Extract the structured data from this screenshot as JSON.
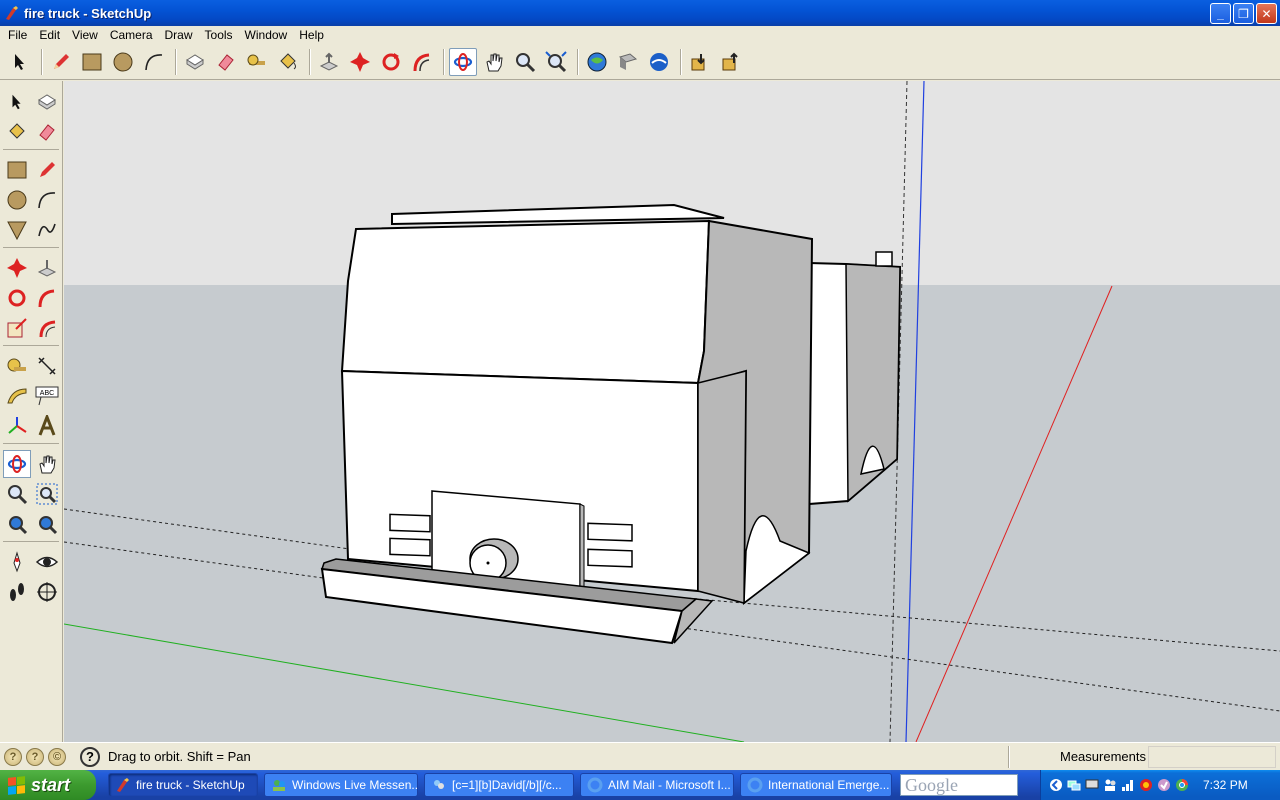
{
  "window": {
    "title": "fire truck - SketchUp",
    "controls": {
      "minimize": "_",
      "restore": "❐",
      "close": "✕"
    }
  },
  "menu": [
    "File",
    "Edit",
    "View",
    "Camera",
    "Draw",
    "Tools",
    "Window",
    "Help"
  ],
  "toolbar": {
    "tools": [
      "select-icon",
      "pencil-icon",
      "rectangle-icon",
      "circle-icon",
      "arc-icon",
      "make-component-icon",
      "eraser-icon",
      "tape-measure-icon",
      "paint-bucket-icon",
      "push-pull-icon",
      "move-icon",
      "rotate-icon",
      "follow-me-icon",
      "orbit-icon",
      "pan-icon",
      "zoom-icon",
      "zoom-extents-icon",
      "get-models-icon",
      "share-model-icon",
      "google-earth-icon",
      "import-icon",
      "export-icon"
    ],
    "active": "orbit-icon"
  },
  "palette": {
    "active": "orbit-icon",
    "text_icon_label": "ABC"
  },
  "status": {
    "hint": "Drag to orbit.  Shift = Pan",
    "measurements_label": "Measurements",
    "measurements_value": "",
    "help_glyph": "?"
  },
  "taskbar": {
    "start_label": "start",
    "tasks": [
      {
        "label": "fire truck - SketchUp",
        "active": true
      },
      {
        "label": "Windows Live Messen...",
        "active": false
      },
      {
        "label": "[c=1][b]David[/b][/c...",
        "active": false
      },
      {
        "label": "AIM Mail - Microsoft I...",
        "active": false
      },
      {
        "label": "International Emerge...",
        "active": false
      }
    ],
    "search_text": "Google",
    "clock": "7:32 PM"
  },
  "colors": {
    "sky": "#e4e4e4",
    "ground": "#c6cbcf",
    "red_axis": "#e02020",
    "green_axis": "#20b020",
    "blue_axis": "#2040e0",
    "model_face": "#ffffff",
    "model_side": "#b8b8b8"
  }
}
